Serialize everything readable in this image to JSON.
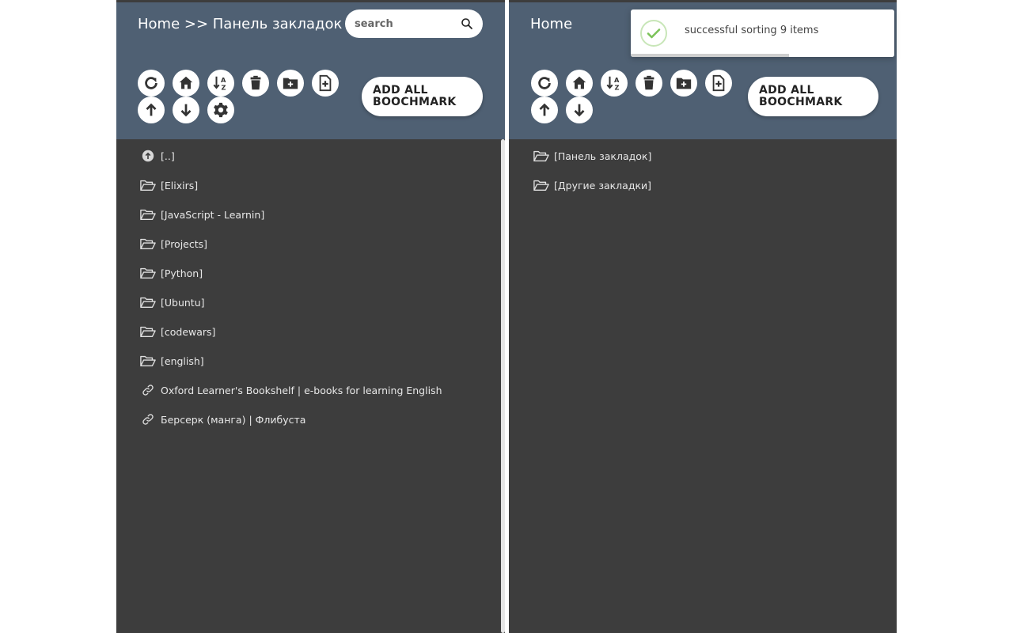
{
  "left_pane": {
    "breadcrumb": "Home >> Панель закладок",
    "search": {
      "placeholder": "search",
      "value": ""
    },
    "add_all_label": "ADD ALL BOOCHMARK",
    "items": [
      {
        "type": "up",
        "label": "[..]"
      },
      {
        "type": "folder",
        "label": "[Elixirs]"
      },
      {
        "type": "folder",
        "label": "[JavaScript - Learnin]"
      },
      {
        "type": "folder",
        "label": "[Projects]"
      },
      {
        "type": "folder",
        "label": "[Python]"
      },
      {
        "type": "folder",
        "label": "[Ubuntu]"
      },
      {
        "type": "folder",
        "label": "[codewars]"
      },
      {
        "type": "folder",
        "label": "[english]"
      },
      {
        "type": "link",
        "label": "Oxford Learner's Bookshelf | e-books for learning English"
      },
      {
        "type": "link",
        "label": "Берсерк (манга) | Флибуста"
      }
    ]
  },
  "right_pane": {
    "breadcrumb": "Home",
    "add_all_label": "ADD ALL BOOCHMARK",
    "items": [
      {
        "type": "folder",
        "label": "[Панель закладок]"
      },
      {
        "type": "folder",
        "label": "[Другие закладки]"
      }
    ]
  },
  "toolbar_icons": [
    "refresh-icon",
    "home-icon",
    "sort-az-icon",
    "trash-icon",
    "add-folder-icon",
    "add-bookmark-icon",
    "arrow-up-icon",
    "arrow-down-icon",
    "gear-icon"
  ],
  "toast": {
    "message": "successful sorting 9 items",
    "progress": 0.6
  },
  "colors": {
    "header": "#4f6073",
    "pane_bg": "#3d3d3d",
    "item_text": "#e8e8e8",
    "toast_check": "#7cc35a"
  }
}
